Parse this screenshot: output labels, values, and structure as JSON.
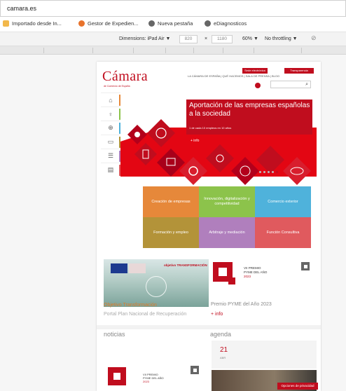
{
  "browser": {
    "url": "camara.es",
    "bookmarks": [
      {
        "label": "Importado desde In...",
        "icon": "folder-icon"
      },
      {
        "label": "Gestor de Expedien...",
        "icon": "gestor-icon"
      },
      {
        "label": "Nueva pestaña",
        "icon": "globe-icon"
      },
      {
        "label": "eDiagnosticos",
        "icon": "globe-icon"
      }
    ],
    "devtools": {
      "device_label": "Dimensions: iPad Air ▼",
      "width": "820",
      "times": "×",
      "height": "1180",
      "zoom": "60% ▼",
      "throttle": "No throttling ▼"
    }
  },
  "site": {
    "logo": "Cámara",
    "logo_sub": "de Comercio de España",
    "top_nav": "LA CÁMARA DE ESPAÑA | QUÉ HACEMOS | SALA DE PRENSA | BLOG",
    "sede_button": "Sede electrónica",
    "transparency_button": "Transparencia",
    "hero": {
      "title": "Aportación de las empresas españolas a la sociedad",
      "subtitle": "1 de cada 10 empleos en 10 años",
      "more": "+ info"
    },
    "tiles": [
      {
        "label": "Creación de empresas",
        "color": "#e6883a"
      },
      {
        "label": "Innovación, digitalización y competitividad",
        "color": "#8cc34b"
      },
      {
        "label": "Comercio exterior",
        "color": "#4fb2db"
      },
      {
        "label": "Formación y empleo",
        "color": "#b39339"
      },
      {
        "label": "Arbitraje y mediación",
        "color": "#b07fbd"
      },
      {
        "label": "Función Consultiva",
        "color": "#e05a5e"
      }
    ],
    "news_image_text": "objetivo TRANSFORMACIÓN",
    "news_caption_1": "Objetivo Transformación",
    "news_caption_2": "Portal Plan Nacional de Recuperación",
    "pyme_badge_line1": "VII PREMIO",
    "pyme_badge_line2": "PYME DEL AÑO",
    "pyme_badge_year": "2023",
    "pyme_title": "Premio PYME del Año 2023",
    "pyme_more": "+ info",
    "section_news": "noticias",
    "section_agenda": "agenda",
    "agenda_day": "21",
    "agenda_month": "ABR",
    "priority_button": "Opciones de privacidad"
  }
}
